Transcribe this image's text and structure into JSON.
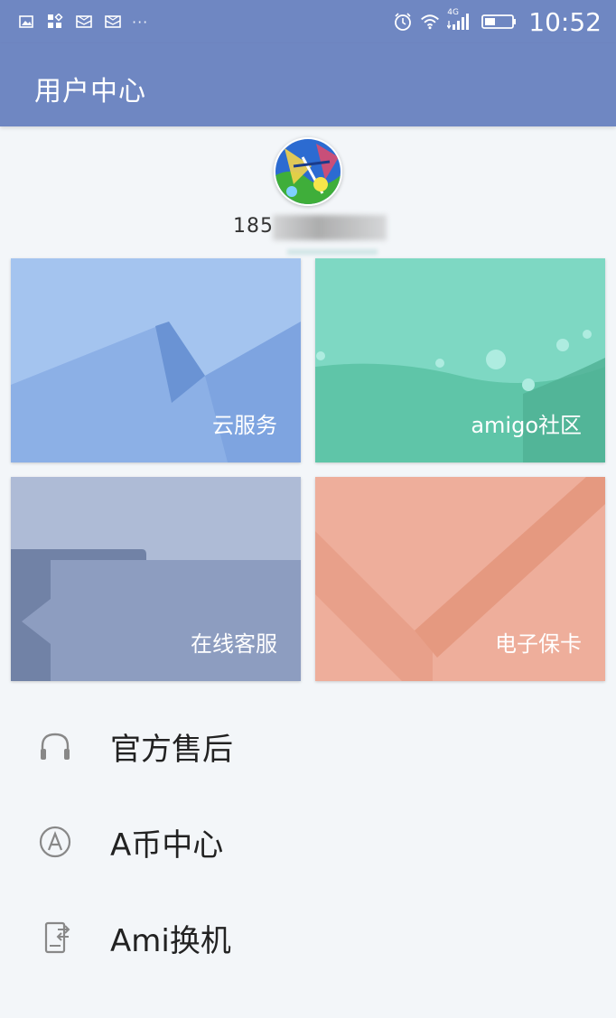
{
  "status_bar": {
    "time": "10:52",
    "network_label": "4G",
    "icons": [
      "image-icon",
      "apps-icon",
      "mail-icon",
      "mail-icon",
      "more-dots-icon",
      "alarm-icon",
      "wifi-icon",
      "signal-icon",
      "battery-icon"
    ],
    "overflow": "···"
  },
  "app_bar": {
    "title": "用户中心"
  },
  "profile": {
    "user_id_visible": "185"
  },
  "tiles": [
    {
      "label": "云服务",
      "color": "#8fb2e8"
    },
    {
      "label": "amigo社区",
      "color": "#78d6c0"
    },
    {
      "label": "在线客服",
      "color": "#a9b6d1"
    },
    {
      "label": "电子保卡",
      "color": "#eeae9b"
    }
  ],
  "menu": [
    {
      "label": "官方售后",
      "icon": "headphones-icon"
    },
    {
      "label": "A币中心",
      "icon": "a-coin-icon"
    },
    {
      "label": "Ami换机",
      "icon": "phone-transfer-icon"
    }
  ],
  "colors": {
    "app_bar": "#6f87c2",
    "background": "#f3f6f9"
  }
}
